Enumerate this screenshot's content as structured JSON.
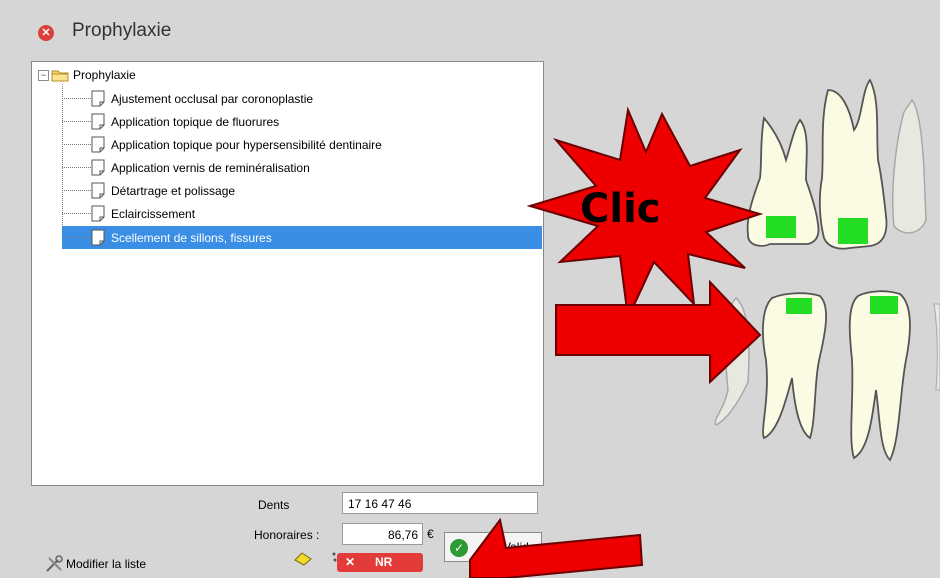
{
  "window": {
    "title": "Prophylaxie"
  },
  "tree": {
    "root_label": "Prophylaxie",
    "expander": "⊟",
    "items": [
      {
        "label": "Ajustement occlusal par coronoplastie",
        "selected": false
      },
      {
        "label": "Application topique de fluorures",
        "selected": false
      },
      {
        "label": "Application topique pour hypersensibilité dentinaire",
        "selected": false
      },
      {
        "label": "Application vernis de reminéralisation",
        "selected": false
      },
      {
        "label": "Détartrage et polissage",
        "selected": false
      },
      {
        "label": "Eclaircissement",
        "selected": false
      },
      {
        "label": "Scellement de sillons, fissures",
        "selected": true
      }
    ]
  },
  "form": {
    "dents_label": "Dents",
    "dents_value": "17 16 47 46",
    "honoraires_label": "Honoraires :",
    "honoraires_value": "86,76",
    "currency": "€",
    "valider_label": "Valider"
  },
  "footer": {
    "modify_label": "Modifier la liste",
    "nr_label": "NR",
    "nr_icon": "✕"
  },
  "annotations": {
    "clic_label": "Clic"
  },
  "colors": {
    "selection": "#3a8ee6",
    "tooth_fill": "#fbfbe3",
    "sealant_green": "#22dd22",
    "annotation_red": "#ee0000",
    "nr_red": "#e33a3a"
  },
  "icons": [
    "close-icon",
    "folder-icon",
    "document-icon",
    "tools-icon",
    "eraser-icon",
    "dots-icon",
    "check-icon"
  ]
}
